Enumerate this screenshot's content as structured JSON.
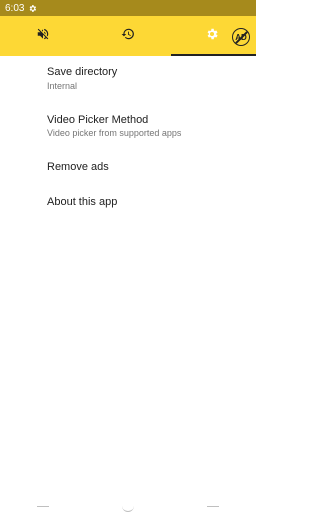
{
  "status_bar": {
    "time": "6:03",
    "icons": [
      "settings-gear-icon"
    ]
  },
  "tabs": {
    "items": [
      {
        "name": "volume-off",
        "icon": "volume-off-icon"
      },
      {
        "name": "history",
        "icon": "history-icon"
      },
      {
        "name": "settings",
        "icon": "gear-icon",
        "selected": true
      }
    ],
    "remove_ads_badge": "AD"
  },
  "settings": {
    "items": [
      {
        "title": "Save directory",
        "summary": "Internal"
      },
      {
        "title": "Video Picker Method",
        "summary": "Video picker from supported apps"
      },
      {
        "title": "Remove ads"
      },
      {
        "title": "About this app"
      }
    ]
  },
  "colors": {
    "status_bar": "#a68a1c",
    "toolbar": "#fdd835",
    "text_primary": "#212121",
    "text_secondary": "#757575",
    "settings_icon": "#ffffff"
  }
}
